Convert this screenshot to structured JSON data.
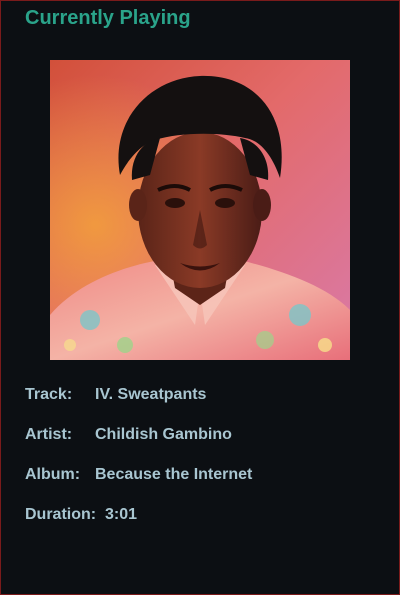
{
  "header": {
    "title": "Currently Playing"
  },
  "album_art": {
    "description": "album-cover-art"
  },
  "track_info": {
    "track_label": "Track:",
    "track_value": "IV. Sweatpants",
    "artist_label": "Artist:",
    "artist_value": "Childish Gambino",
    "album_label": "Album:",
    "album_value": "Because the Internet",
    "duration_label": "Duration:",
    "duration_value": "3:01"
  },
  "colors": {
    "background": "#0c0f13",
    "title": "#2aa38a",
    "text": "#a9c6d1",
    "border": "#7a1b1b"
  }
}
